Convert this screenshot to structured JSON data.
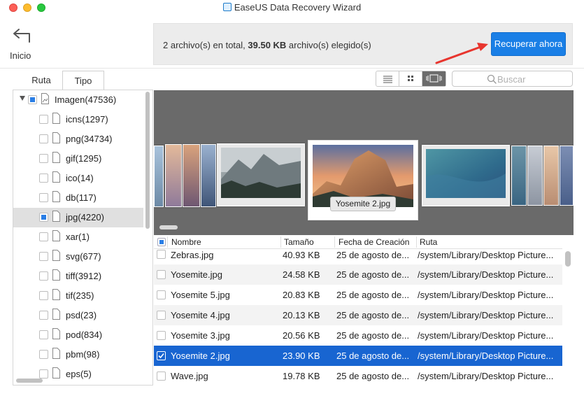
{
  "window": {
    "title": "EaseUS Data Recovery Wizard"
  },
  "header": {
    "back_label": "Inicio",
    "summary_prefix": "2 archivo(s) en total, ",
    "summary_size": "39.50 KB",
    "summary_suffix": " archivo(s) elegido(s)",
    "recover_button": "Recuperar ahora"
  },
  "tabs": [
    {
      "label": "Ruta",
      "active": false
    },
    {
      "label": "Tipo",
      "active": true
    }
  ],
  "search": {
    "placeholder": "Buscar"
  },
  "view": {
    "active": "cover-flow"
  },
  "tree": {
    "root": {
      "label": "Imagen(47536)",
      "state": "partial"
    },
    "items": [
      {
        "label": "icns(1297)",
        "state": "unchecked",
        "selected": false
      },
      {
        "label": "png(34734)",
        "state": "unchecked",
        "selected": false
      },
      {
        "label": "gif(1295)",
        "state": "unchecked",
        "selected": false
      },
      {
        "label": "ico(14)",
        "state": "unchecked",
        "selected": false
      },
      {
        "label": "db(117)",
        "state": "unchecked",
        "selected": false
      },
      {
        "label": "jpg(4220)",
        "state": "partial",
        "selected": true
      },
      {
        "label": "xar(1)",
        "state": "unchecked",
        "selected": false
      },
      {
        "label": "svg(677)",
        "state": "unchecked",
        "selected": false
      },
      {
        "label": "tiff(3912)",
        "state": "unchecked",
        "selected": false
      },
      {
        "label": "tif(235)",
        "state": "unchecked",
        "selected": false
      },
      {
        "label": "psd(23)",
        "state": "unchecked",
        "selected": false
      },
      {
        "label": "pod(834)",
        "state": "unchecked",
        "selected": false
      },
      {
        "label": "pbm(98)",
        "state": "unchecked",
        "selected": false
      },
      {
        "label": "eps(5)",
        "state": "unchecked",
        "selected": false
      }
    ]
  },
  "preview": {
    "caption": "Yosemite 2.jpg"
  },
  "table": {
    "columns": [
      "Nombre",
      "Tamaño",
      "Fecha de Creación",
      "Ruta"
    ],
    "rows": [
      {
        "name": "Zebras.jpg",
        "size": "40.93 KB",
        "date": "25 de agosto de...",
        "path": "/system/Library/Desktop Picture...",
        "checked": false,
        "selected": false
      },
      {
        "name": "Yosemite.jpg",
        "size": "24.58 KB",
        "date": "25 de agosto de...",
        "path": "/system/Library/Desktop Picture...",
        "checked": false,
        "selected": false
      },
      {
        "name": "Yosemite 5.jpg",
        "size": "20.83 KB",
        "date": "25 de agosto de...",
        "path": "/system/Library/Desktop Picture...",
        "checked": false,
        "selected": false
      },
      {
        "name": "Yosemite 4.jpg",
        "size": "20.13 KB",
        "date": "25 de agosto de...",
        "path": "/system/Library/Desktop Picture...",
        "checked": false,
        "selected": false
      },
      {
        "name": "Yosemite 3.jpg",
        "size": "20.56 KB",
        "date": "25 de agosto de...",
        "path": "/system/Library/Desktop Picture...",
        "checked": false,
        "selected": false
      },
      {
        "name": "Yosemite 2.jpg",
        "size": "23.90 KB",
        "date": "25 de agosto de...",
        "path": "/system/Library/Desktop Picture...",
        "checked": true,
        "selected": true
      },
      {
        "name": "Wave.jpg",
        "size": "19.78 KB",
        "date": "25 de agosto de...",
        "path": "/system/Library/Desktop Picture...",
        "checked": false,
        "selected": false
      }
    ]
  },
  "colors": {
    "accent": "#1a7fe6",
    "selection": "#1865d1",
    "arrow": "#e8352e"
  }
}
